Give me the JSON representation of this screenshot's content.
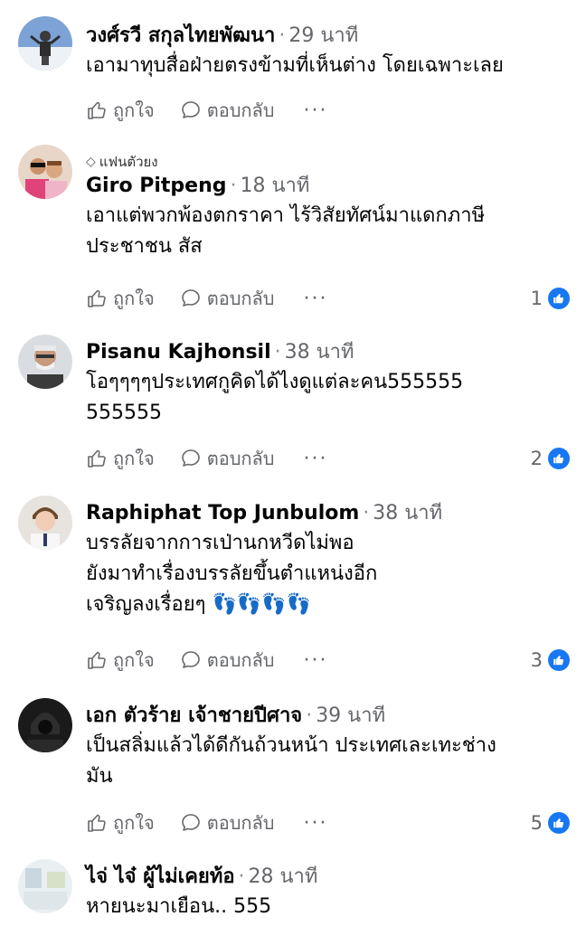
{
  "comments": [
    {
      "name": "วงศ์รวี สกุลไทยพัฒนา",
      "time": "29 นาที",
      "text": "เอามาทุบสื่อฝ่ายตรงข้ามที่เห็นต่าง โดยเฉพาะเลย",
      "like_label": "ถูกใจ",
      "reply_label": "ตอบกลับ",
      "more": "···"
    },
    {
      "badge": "แฟนตัวยง",
      "name": "Giro Pitpeng",
      "time": "18 นาที",
      "text_lines": [
        "เอาแต่พวกพ้องตกราคา ไร้วิสัยทัศน์มาแดกภาษี",
        "ประชาชน สัส"
      ],
      "like_label": "ถูกใจ",
      "reply_label": "ตอบกลับ",
      "more": "···",
      "reaction_count": "1"
    },
    {
      "name": "Pisanu Kajhonsil",
      "time": "38 นาที",
      "text_lines": [
        "โอๆๆๆๆประเทศกูคิดได้ไงดูแต่ละคน555555",
        "555555"
      ],
      "like_label": "ถูกใจ",
      "reply_label": "ตอบกลับ",
      "more": "···",
      "reaction_count": "2"
    },
    {
      "name": "Raphiphat Top Junbulom",
      "time": "38 นาที",
      "text_lines": [
        "บรรลัยจากการเป่านกหวีดไม่พอ",
        "ยังมาทำเรื่องบรรลัยขึ้นตำแหน่งอีก",
        "เจริญลงเรื่อยๆ 👣👣👣👣"
      ],
      "like_label": "ถูกใจ",
      "reply_label": "ตอบกลับ",
      "more": "···",
      "reaction_count": "3"
    },
    {
      "name": "เอก ตัวร้าย เจ้าชายปีศาจ",
      "time": "39 นาที",
      "text_lines": [
        "เป็นสลิ่มแล้วได้ดีกันถ้วนหน้า ประเทศเละเทะช่าง",
        "มัน"
      ],
      "like_label": "ถูกใจ",
      "reply_label": "ตอบกลับ",
      "more": "···",
      "reaction_count": "5"
    },
    {
      "name": "ไจ่ ไจ๋ ผู้ไม่เคยท้อ",
      "time": "28 นาที",
      "text": "หายนะมาเยือน.. 555"
    }
  ],
  "colors": {
    "accent": "#1877f2",
    "meta": "#65676b"
  },
  "icons": {
    "like": "thumbs-up-icon",
    "reply": "speech-bubble-icon",
    "reaction": "like-reaction-icon",
    "fan": "diamond-icon"
  }
}
